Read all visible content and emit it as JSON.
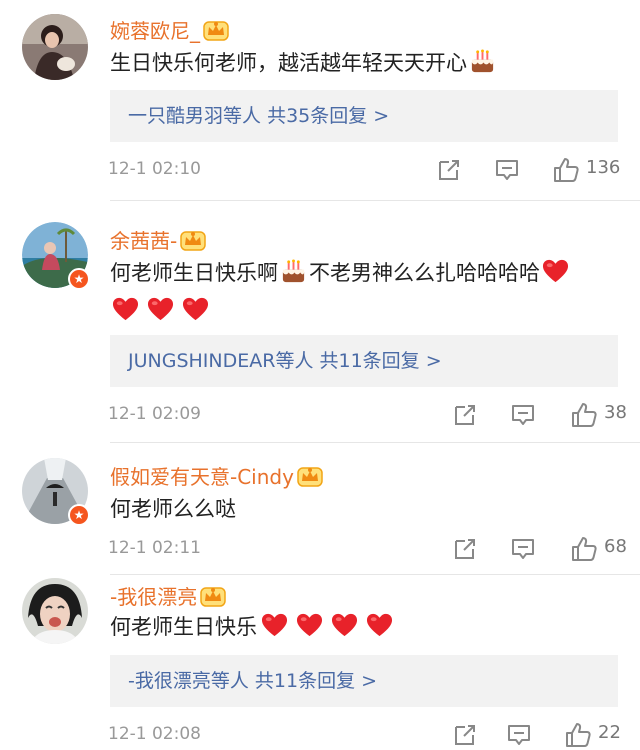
{
  "comments": [
    {
      "username": "婉蓉欧尼_",
      "text_before": "生日快乐何老师，越活越年轻天天开心",
      "replies_users": "一只酷男羽等人",
      "replies_count": "共35条回复 >",
      "time": "12-1 02:10",
      "likes": "136",
      "verified": false
    },
    {
      "username": "余茜茜-",
      "text_before": "何老师生日快乐啊",
      "text_after": "不老男神么么扎哈哈哈哈",
      "replies_users": "JUNGSHINDEAR等人",
      "replies_count": "共11条回复 >",
      "time": "12-1 02:09",
      "likes": "38",
      "verified": true
    },
    {
      "username": "假如爱有天意-Cindy",
      "text_before": "何老师么么哒",
      "time": "12-1 02:11",
      "likes": "68",
      "verified": true
    },
    {
      "username": "-我很漂亮",
      "text_before": "何老师生日快乐",
      "replies_users": "-我很漂亮等人",
      "replies_count": "共11条回复 >",
      "time": "12-1 02:08",
      "likes": "22",
      "verified": false
    }
  ],
  "icons": {
    "crown": "crown-badge-icon",
    "cake": "birthday-cake-emoji",
    "heart": "red-heart-emoji",
    "repost": "repost-icon",
    "comment": "comment-icon",
    "like": "thumbs-up-icon"
  },
  "colors": {
    "username": "#e8722c",
    "reply_link": "#4a6aa5",
    "reply_bg": "#f2f2f2",
    "meta": "#999999"
  }
}
